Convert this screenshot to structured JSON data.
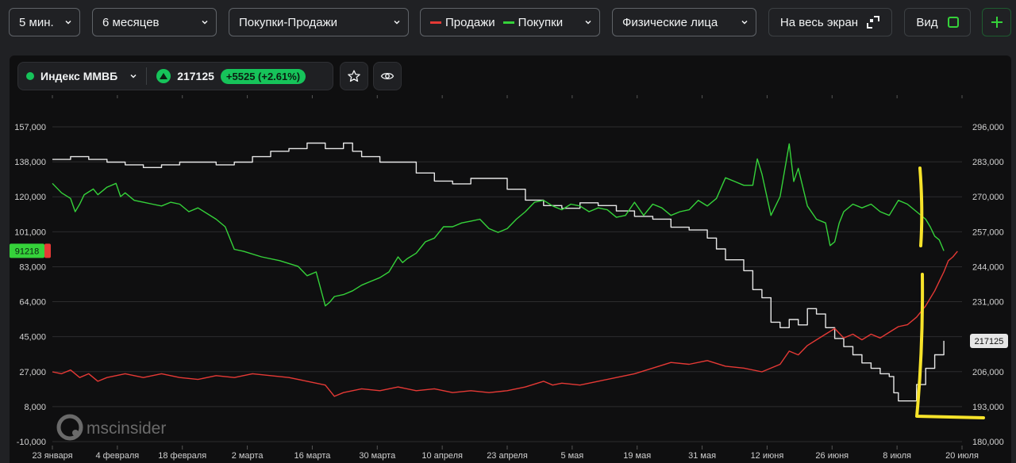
{
  "toolbar": {
    "interval": "5 мин.",
    "period": "6 месяцев",
    "mode": "Покупки-Продажи",
    "legend": [
      {
        "label": "Продажи",
        "color": "#e53935"
      },
      {
        "label": "Покупки",
        "color": "#35d23a"
      }
    ],
    "participants": "Физические лица",
    "fullscreen_label": "На весь экран",
    "view_label": "Вид"
  },
  "ticker": {
    "name": "Индекс ММВБ",
    "price": "217125",
    "change": "+5525 (+2.61%)"
  },
  "watermark": "mscinsider",
  "chart_data": {
    "type": "line",
    "x_ticks": [
      "23 января",
      "4 февраля",
      "18 февраля",
      "2 марта",
      "16 марта",
      "30 марта",
      "10 апреля",
      "23 апреля",
      "5 мая",
      "19 мая",
      "31 мая",
      "12 июня",
      "26 июня",
      "8 июля",
      "20 июля"
    ],
    "y_left_ticks": [
      "157,000",
      "138,000",
      "120,000",
      "101,000",
      "83,000",
      "64,000",
      "45,000",
      "27,000",
      "8,000",
      "-10,000"
    ],
    "y_right_ticks": [
      "296,000",
      "283,000",
      "270,000",
      "257,000",
      "244,000",
      "231,000",
      "219,000",
      "206,000",
      "193,000",
      "180,000"
    ],
    "y_left_range": [
      -10000,
      157000
    ],
    "y_right_range": [
      180000,
      296000
    ],
    "last_left_value_label": "91218",
    "last_right_value_label": "217125",
    "series": [
      {
        "name": "Покупки",
        "axis": "left",
        "color": "#35d23a",
        "points": [
          [
            0,
            127000
          ],
          [
            0.01,
            122000
          ],
          [
            0.02,
            119000
          ],
          [
            0.025,
            112000
          ],
          [
            0.03,
            116000
          ],
          [
            0.035,
            121000
          ],
          [
            0.045,
            124000
          ],
          [
            0.05,
            121000
          ],
          [
            0.06,
            125000
          ],
          [
            0.07,
            127000
          ],
          [
            0.075,
            120000
          ],
          [
            0.08,
            122000
          ],
          [
            0.09,
            118000
          ],
          [
            0.1,
            117000
          ],
          [
            0.11,
            116000
          ],
          [
            0.12,
            115000
          ],
          [
            0.13,
            117000
          ],
          [
            0.14,
            116000
          ],
          [
            0.15,
            112000
          ],
          [
            0.16,
            114000
          ],
          [
            0.18,
            108000
          ],
          [
            0.19,
            104000
          ],
          [
            0.2,
            92000
          ],
          [
            0.21,
            91000
          ],
          [
            0.23,
            88000
          ],
          [
            0.25,
            86000
          ],
          [
            0.27,
            83000
          ],
          [
            0.28,
            78000
          ],
          [
            0.29,
            80000
          ],
          [
            0.3,
            62000
          ],
          [
            0.305,
            64000
          ],
          [
            0.31,
            67000
          ],
          [
            0.32,
            68000
          ],
          [
            0.33,
            70000
          ],
          [
            0.34,
            73000
          ],
          [
            0.35,
            75000
          ],
          [
            0.36,
            77000
          ],
          [
            0.37,
            80000
          ],
          [
            0.38,
            88000
          ],
          [
            0.385,
            85000
          ],
          [
            0.39,
            87000
          ],
          [
            0.4,
            90000
          ],
          [
            0.41,
            96000
          ],
          [
            0.42,
            98000
          ],
          [
            0.43,
            104000
          ],
          [
            0.44,
            104000
          ],
          [
            0.45,
            106000
          ],
          [
            0.46,
            107000
          ],
          [
            0.47,
            108000
          ],
          [
            0.48,
            103000
          ],
          [
            0.49,
            101000
          ],
          [
            0.5,
            103000
          ],
          [
            0.51,
            108000
          ],
          [
            0.52,
            112000
          ],
          [
            0.53,
            117000
          ],
          [
            0.54,
            118000
          ],
          [
            0.55,
            115000
          ],
          [
            0.56,
            113000
          ],
          [
            0.57,
            116000
          ],
          [
            0.58,
            115000
          ],
          [
            0.59,
            112000
          ],
          [
            0.6,
            114000
          ],
          [
            0.61,
            113000
          ],
          [
            0.62,
            109000
          ],
          [
            0.63,
            110000
          ],
          [
            0.64,
            117000
          ],
          [
            0.65,
            110000
          ],
          [
            0.66,
            116000
          ],
          [
            0.67,
            114000
          ],
          [
            0.68,
            110000
          ],
          [
            0.69,
            112000
          ],
          [
            0.7,
            113000
          ],
          [
            0.71,
            118000
          ],
          [
            0.72,
            115000
          ],
          [
            0.73,
            119000
          ],
          [
            0.74,
            130000
          ],
          [
            0.75,
            128000
          ],
          [
            0.76,
            126000
          ],
          [
            0.77,
            126000
          ],
          [
            0.775,
            140000
          ],
          [
            0.78,
            132000
          ],
          [
            0.79,
            110000
          ],
          [
            0.8,
            120000
          ],
          [
            0.81,
            148000
          ],
          [
            0.815,
            128000
          ],
          [
            0.82,
            135000
          ],
          [
            0.83,
            115000
          ],
          [
            0.84,
            108000
          ],
          [
            0.85,
            106000
          ],
          [
            0.855,
            94000
          ],
          [
            0.86,
            96000
          ],
          [
            0.865,
            106000
          ],
          [
            0.87,
            112000
          ],
          [
            0.88,
            116000
          ],
          [
            0.89,
            114000
          ],
          [
            0.9,
            116000
          ],
          [
            0.91,
            112000
          ],
          [
            0.92,
            110000
          ],
          [
            0.93,
            118000
          ],
          [
            0.94,
            116000
          ],
          [
            0.95,
            112000
          ],
          [
            0.96,
            108000
          ],
          [
            0.965,
            104000
          ],
          [
            0.97,
            99000
          ],
          [
            0.975,
            97000
          ],
          [
            0.98,
            91218
          ]
        ]
      },
      {
        "name": "Продажи",
        "axis": "left",
        "color": "#e53935",
        "points": [
          [
            0,
            27000
          ],
          [
            0.01,
            26000
          ],
          [
            0.02,
            28000
          ],
          [
            0.03,
            24000
          ],
          [
            0.04,
            26000
          ],
          [
            0.05,
            22000
          ],
          [
            0.06,
            24000
          ],
          [
            0.08,
            26000
          ],
          [
            0.1,
            24000
          ],
          [
            0.12,
            26000
          ],
          [
            0.14,
            24000
          ],
          [
            0.16,
            23000
          ],
          [
            0.18,
            25000
          ],
          [
            0.2,
            24000
          ],
          [
            0.22,
            26000
          ],
          [
            0.24,
            25000
          ],
          [
            0.26,
            24000
          ],
          [
            0.28,
            22000
          ],
          [
            0.3,
            20000
          ],
          [
            0.31,
            14000
          ],
          [
            0.32,
            16000
          ],
          [
            0.34,
            18000
          ],
          [
            0.36,
            17000
          ],
          [
            0.38,
            19000
          ],
          [
            0.4,
            17000
          ],
          [
            0.42,
            18000
          ],
          [
            0.44,
            16000
          ],
          [
            0.46,
            17000
          ],
          [
            0.48,
            16000
          ],
          [
            0.5,
            17000
          ],
          [
            0.52,
            19000
          ],
          [
            0.54,
            22000
          ],
          [
            0.55,
            20000
          ],
          [
            0.56,
            21000
          ],
          [
            0.58,
            20000
          ],
          [
            0.6,
            22000
          ],
          [
            0.62,
            24000
          ],
          [
            0.64,
            26000
          ],
          [
            0.66,
            29000
          ],
          [
            0.68,
            32000
          ],
          [
            0.7,
            31000
          ],
          [
            0.72,
            33000
          ],
          [
            0.74,
            30000
          ],
          [
            0.76,
            29000
          ],
          [
            0.78,
            27000
          ],
          [
            0.8,
            31000
          ],
          [
            0.81,
            38000
          ],
          [
            0.82,
            36000
          ],
          [
            0.83,
            41000
          ],
          [
            0.84,
            44000
          ],
          [
            0.85,
            47000
          ],
          [
            0.86,
            50000
          ],
          [
            0.87,
            45000
          ],
          [
            0.88,
            47000
          ],
          [
            0.89,
            44000
          ],
          [
            0.9,
            47000
          ],
          [
            0.91,
            45000
          ],
          [
            0.92,
            48000
          ],
          [
            0.93,
            51000
          ],
          [
            0.94,
            52000
          ],
          [
            0.95,
            56000
          ],
          [
            0.96,
            62000
          ],
          [
            0.97,
            70000
          ],
          [
            0.975,
            75000
          ],
          [
            0.98,
            80000
          ],
          [
            0.985,
            86000
          ],
          [
            0.99,
            88000
          ],
          [
            0.995,
            91000
          ]
        ]
      },
      {
        "name": "Индекс ММВБ",
        "axis": "right",
        "color": "#e6e6e6",
        "points": [
          [
            0,
            284000
          ],
          [
            0.02,
            285000
          ],
          [
            0.04,
            284000
          ],
          [
            0.06,
            283000
          ],
          [
            0.08,
            282000
          ],
          [
            0.1,
            281000
          ],
          [
            0.12,
            282000
          ],
          [
            0.14,
            283000
          ],
          [
            0.16,
            283000
          ],
          [
            0.18,
            282000
          ],
          [
            0.2,
            283000
          ],
          [
            0.22,
            285000
          ],
          [
            0.24,
            287000
          ],
          [
            0.26,
            288000
          ],
          [
            0.28,
            290000
          ],
          [
            0.3,
            288000
          ],
          [
            0.32,
            290000
          ],
          [
            0.33,
            287000
          ],
          [
            0.34,
            285000
          ],
          [
            0.36,
            283000
          ],
          [
            0.38,
            283000
          ],
          [
            0.4,
            279000
          ],
          [
            0.42,
            276000
          ],
          [
            0.44,
            275000
          ],
          [
            0.46,
            277000
          ],
          [
            0.48,
            277000
          ],
          [
            0.5,
            273000
          ],
          [
            0.52,
            269000
          ],
          [
            0.54,
            267000
          ],
          [
            0.56,
            266000
          ],
          [
            0.58,
            268000
          ],
          [
            0.6,
            267000
          ],
          [
            0.62,
            265000
          ],
          [
            0.64,
            263000
          ],
          [
            0.66,
            262000
          ],
          [
            0.68,
            259000
          ],
          [
            0.7,
            258000
          ],
          [
            0.72,
            255000
          ],
          [
            0.73,
            251000
          ],
          [
            0.74,
            247000
          ],
          [
            0.76,
            243000
          ],
          [
            0.77,
            236000
          ],
          [
            0.78,
            233000
          ],
          [
            0.79,
            224000
          ],
          [
            0.8,
            222000
          ],
          [
            0.81,
            225000
          ],
          [
            0.82,
            223000
          ],
          [
            0.83,
            229000
          ],
          [
            0.84,
            227000
          ],
          [
            0.85,
            222000
          ],
          [
            0.86,
            218000
          ],
          [
            0.87,
            215000
          ],
          [
            0.88,
            212000
          ],
          [
            0.89,
            209000
          ],
          [
            0.9,
            207000
          ],
          [
            0.91,
            205000
          ],
          [
            0.92,
            204000
          ],
          [
            0.925,
            198000
          ],
          [
            0.93,
            195000
          ],
          [
            0.94,
            195000
          ],
          [
            0.95,
            201000
          ],
          [
            0.96,
            207000
          ],
          [
            0.97,
            212000
          ],
          [
            0.98,
            217125
          ]
        ]
      }
    ]
  }
}
